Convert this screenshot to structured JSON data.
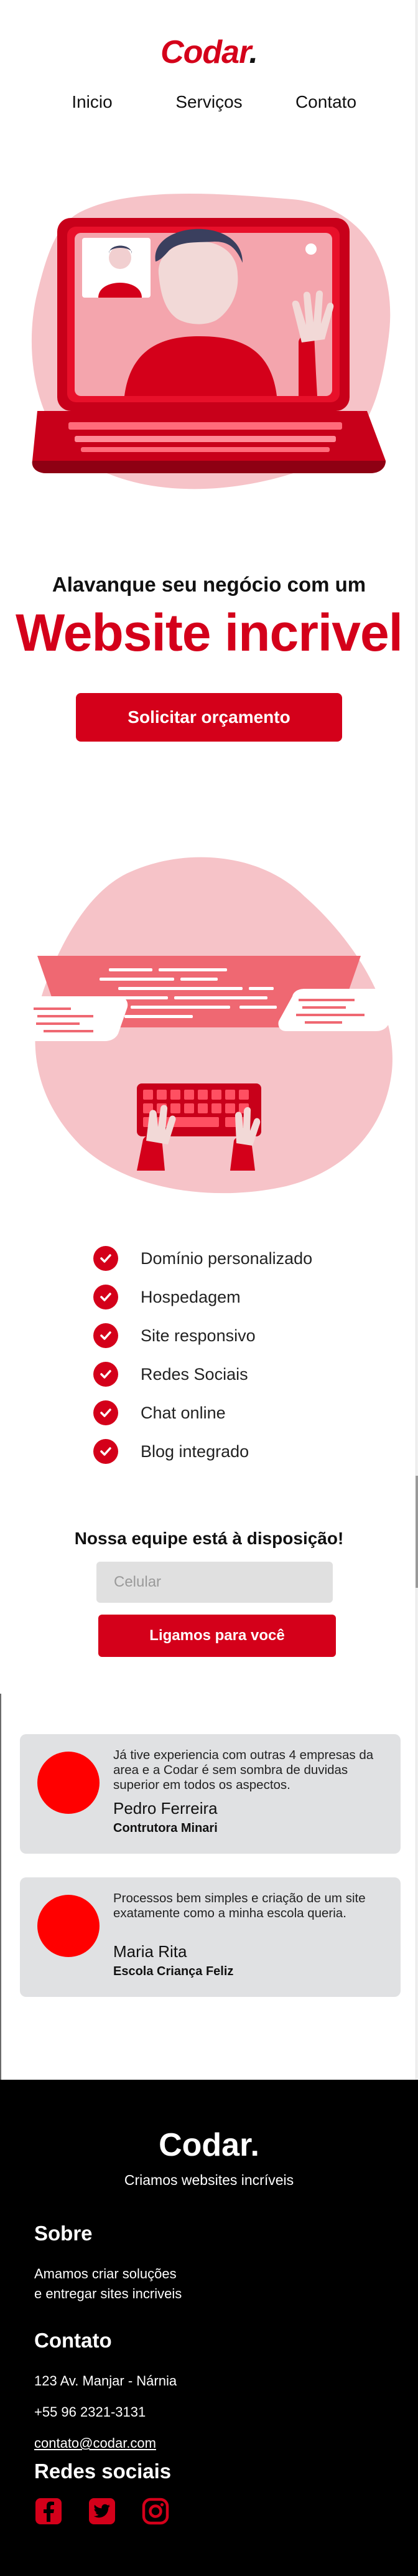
{
  "header": {
    "logo_text": "Codar",
    "logo_dot": ".",
    "nav": [
      "Inicio",
      "Serviços",
      "Contato"
    ]
  },
  "hero": {
    "subtitle": "Alavanque seu negócio com um",
    "title": "Website incrivel",
    "cta_label": "Solicitar orçamento"
  },
  "features": [
    "Domínio personalizado",
    "Hospedagem",
    "Site responsivo",
    "Redes Sociais",
    "Chat online",
    "Blog integrado"
  ],
  "contact_form": {
    "title": "Nossa equipe está à disposição!",
    "phone_placeholder": "Celular",
    "submit_label": "Ligamos para você"
  },
  "testimonials": [
    {
      "quote": "Já tive experiencia com outras 4 empresas da area e a Codar é sem sombra de duvidas superior em todos os aspectos.",
      "name": "Pedro Ferreira",
      "company": "Contrutora Minari"
    },
    {
      "quote": "Processos bem simples e criação de um site exatamente como a minha escola queria.",
      "name": "Maria Rita",
      "company": "Escola Criança Feliz"
    }
  ],
  "footer": {
    "logo_text": "Codar.",
    "tagline": "Criamos websites incríveis",
    "about_heading": "Sobre",
    "about_line1": "Amamos criar soluções",
    "about_line2": "e entregar sites incriveis",
    "contact_heading": "Contato",
    "address": "123 Av. Manjar - Nárnia",
    "phone": "+55 96 2321-3131",
    "email": "contato@codar.com",
    "social_heading": "Redes sociais",
    "social_icons": [
      "facebook-icon",
      "twitter-icon",
      "instagram-icon"
    ]
  },
  "colors": {
    "brand": "#d4001a",
    "avatar": "#ff0000",
    "card_bg": "#e0e1e3",
    "footer_bg": "#000000"
  }
}
